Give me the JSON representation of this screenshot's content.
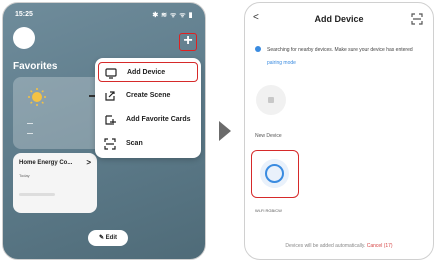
{
  "left_screen": {
    "status_time": "15:25",
    "status_icons": "✱ ≋ ᯤ ᯤ ▮",
    "favorites_title": "Favorites",
    "energy_card_title": "Home Energy Co...",
    "energy_chevron": ">",
    "energy_card_sub": "Today",
    "add_button_glyph": "+",
    "menu_items": [
      {
        "label": "Add Device",
        "icon": "device-icon",
        "highlighted": true
      },
      {
        "label": "Create Scene",
        "icon": "scene-icon",
        "highlighted": false
      },
      {
        "label": "Add Favorite Cards",
        "icon": "favorite-cards-icon",
        "highlighted": false
      },
      {
        "label": "Scan",
        "icon": "scan-icon",
        "highlighted": false
      }
    ],
    "edit_label": "✎ Edit"
  },
  "right_screen": {
    "back_glyph": "<",
    "title": "Add Device",
    "info_text": "Searching for nearby devices. Make sure your device has entered ",
    "info_link": "pairing mode",
    "devices": [
      {
        "label": "New Device",
        "icon": "device-icon",
        "highlighted": false
      },
      {
        "label": "Wi-Fi RGB/CW",
        "icon": "bulb-icon",
        "highlighted": true
      }
    ],
    "footer_text": "Devices will be added automatically. ",
    "footer_cancel": "Cancel (17)"
  },
  "colors": {
    "highlight": "#d62a2a",
    "link": "#3a8be0",
    "phone_bg_left": "#5c7a89"
  }
}
